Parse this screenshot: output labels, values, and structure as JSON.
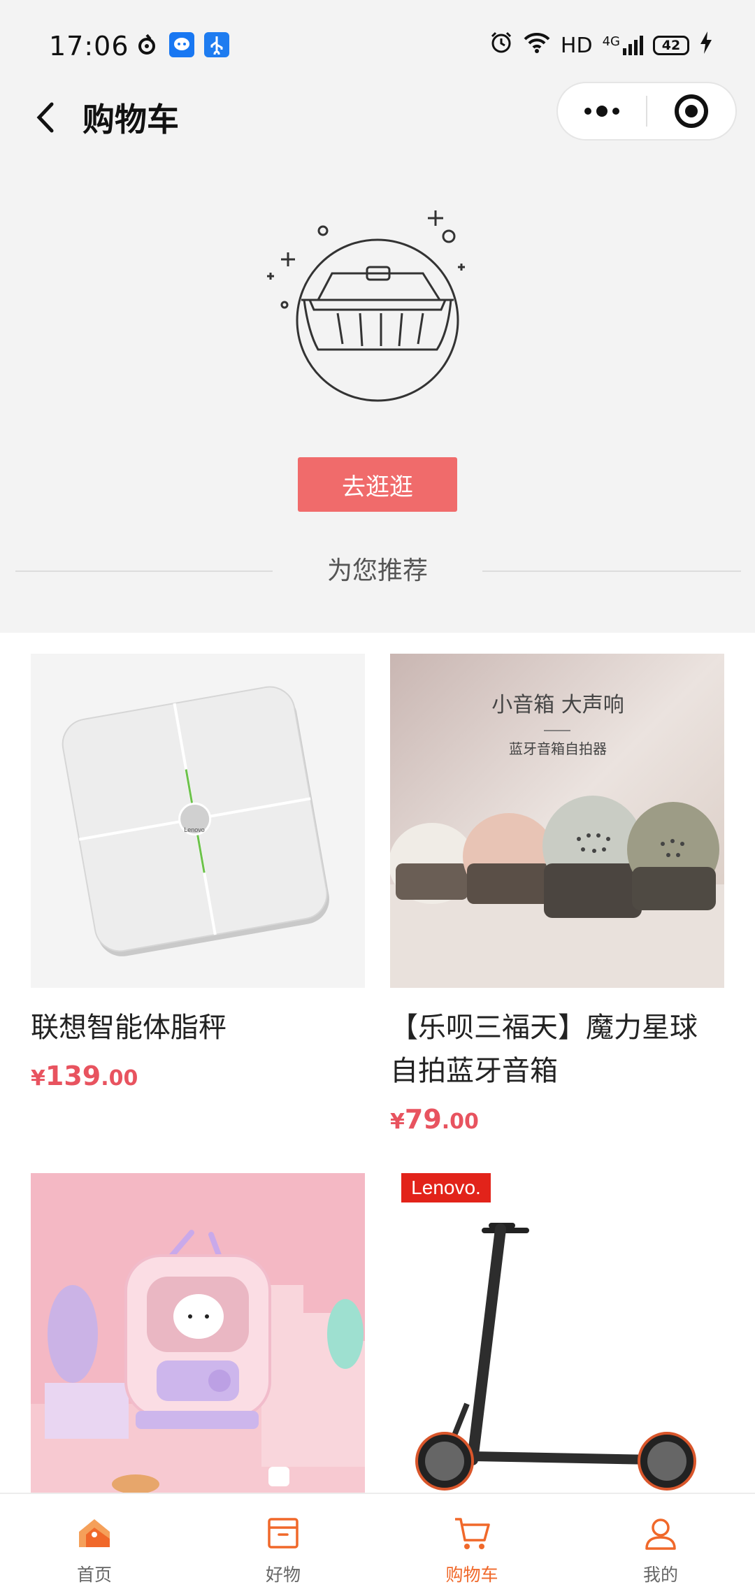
{
  "status_bar": {
    "time": "17:06",
    "network": "HD",
    "signal": "4G",
    "battery": "42",
    "icons": [
      "swirl-icon",
      "chat-bubble-icon",
      "usb-icon",
      "alarm-icon",
      "wifi-icon",
      "charging-icon"
    ]
  },
  "nav": {
    "title": "购物车",
    "back_icon": "chevron-left-icon",
    "more_icon": "more-dots-icon",
    "close_icon": "target-circle-icon"
  },
  "empty_cart": {
    "illustration": "empty-basket-icon",
    "button_label": "去逛逛"
  },
  "recommend": {
    "title": "为您推荐"
  },
  "products": [
    {
      "name": "联想智能体脂秤",
      "currency": "¥",
      "price_int": "139",
      "price_dec": ".00",
      "image_text": "Lenovo",
      "bg": "#f4f4f4"
    },
    {
      "name": "【乐呗三福天】魔力星球自拍蓝牙音箱",
      "currency": "¥",
      "price_int": "79",
      "price_dec": ".00",
      "image_text": "小音箱 大声响",
      "image_subtext": "蓝牙音箱自拍器",
      "bg": "#d8c9c6"
    },
    {
      "name": "",
      "image_text": "",
      "bg": "#f3b7c3"
    },
    {
      "name": "",
      "image_text": "Lenovo.",
      "bg": "#ffffff"
    }
  ],
  "tabs": [
    {
      "label": "首页",
      "icon": "home-icon",
      "active": false
    },
    {
      "label": "好物",
      "icon": "box-icon",
      "active": false
    },
    {
      "label": "购物车",
      "icon": "cart-icon",
      "active": true
    },
    {
      "label": "我的",
      "icon": "user-icon",
      "active": false
    }
  ],
  "colors": {
    "accent": "#f0682a",
    "price": "#e8535f",
    "button": "#f06b6b"
  }
}
